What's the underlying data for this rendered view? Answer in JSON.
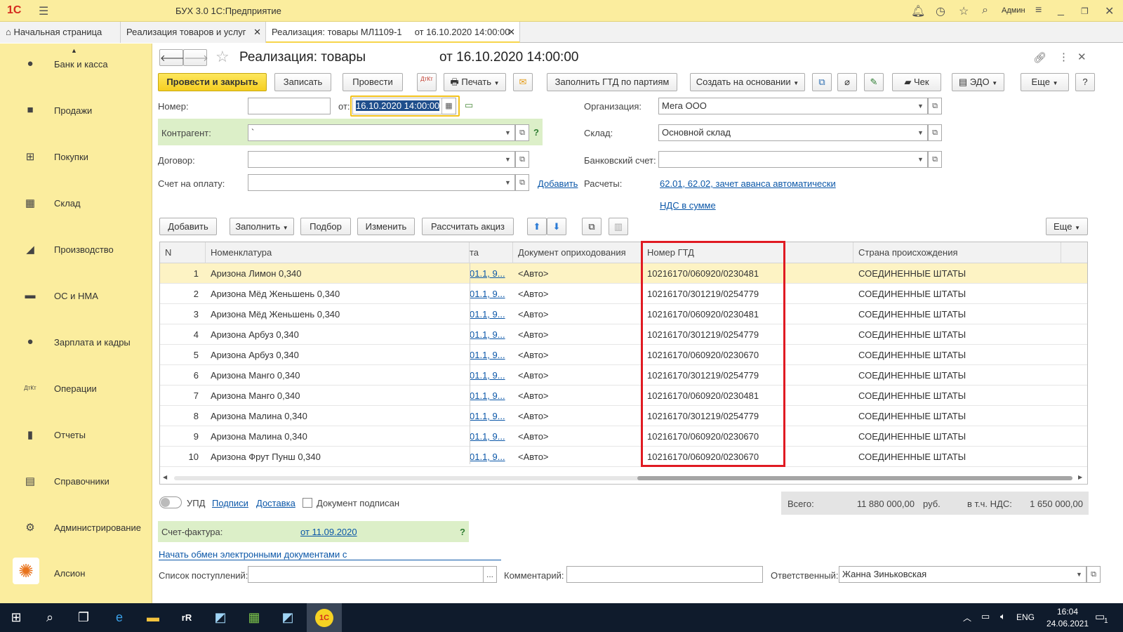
{
  "app": {
    "logo": "1С",
    "title": "БУХ 3.0 1С:Предприятие",
    "user": "Админ"
  },
  "tabs": [
    "Начальная страница",
    "Реализация товаров и услуг",
    "Реализация: товары МЛ1109-1     от 16.10.2020 14:00:00"
  ],
  "sidebar": [
    {
      "label": "Банк и касса",
      "icon": "bank-icon"
    },
    {
      "label": "Продажи",
      "icon": "bag-icon"
    },
    {
      "label": "Покупки",
      "icon": "cart-icon"
    },
    {
      "label": "Склад",
      "icon": "warehouse-icon"
    },
    {
      "label": "Производство",
      "icon": "factory-icon"
    },
    {
      "label": "ОС и НМА",
      "icon": "truck-icon"
    },
    {
      "label": "Зарплата и кадры",
      "icon": "person-icon"
    },
    {
      "label": "Операции",
      "icon": "dtkt-icon"
    },
    {
      "label": "Отчеты",
      "icon": "chart-icon"
    },
    {
      "label": "Справочники",
      "icon": "book-icon"
    },
    {
      "label": "Администрирование",
      "icon": "gear-icon"
    },
    {
      "label": "Алсион",
      "icon": "sun-logo-icon"
    }
  ],
  "doc": {
    "title": "Реализация: товары",
    "date_title": "от 16.10.2020 14:00:00"
  },
  "toolbar": {
    "post_close": "Провести и закрыть",
    "save": "Записать",
    "post": "Провести",
    "dtkt": "ДтКт",
    "print": "Печать",
    "fill_gtd": "Заполнить ГТД по партиям",
    "create_based": "Создать на основании",
    "check": "Чек",
    "edo": "ЭДО",
    "more": "Еще",
    "help": "?"
  },
  "form": {
    "number_label": "Номер:",
    "number_value": "",
    "from_label": "от:",
    "date_value": "16.10.2020 14:00:00",
    "org_label": "Организация:",
    "org_value": "Мега ООО",
    "counterparty_label": "Контрагент:",
    "counterparty_value": "`",
    "warehouse_label": "Склад:",
    "warehouse_value": "Основной склад",
    "contract_label": "Договор:",
    "contract_value": "",
    "bank_label": "Банковский счет:",
    "bank_value": "",
    "invoice_label": "Счет на оплату:",
    "invoice_value": "",
    "add_link": "Добавить",
    "calc_label": "Расчеты:",
    "calc_link": "62.01, 62.02, зачет аванса автоматически",
    "vat_link": "НДС в сумме"
  },
  "table_toolbar": {
    "add": "Добавить",
    "fill": "Заполнить",
    "select": "Подбор",
    "change": "Изменить",
    "excise": "Рассчитать акциз",
    "more": "Еще"
  },
  "table": {
    "headers": [
      "N",
      "Номенклатура",
      "та",
      "Документ оприходования",
      "Номер ГТД",
      "Страна происхождения"
    ],
    "rows": [
      {
        "n": "1",
        "item": "Аризона Лимон 0,340",
        "acc": "01.1, 9...",
        "doc": "<Авто>",
        "gtd": "10216170/060920/0230481",
        "country": "СОЕДИНЕННЫЕ ШТАТЫ"
      },
      {
        "n": "2",
        "item": "Аризона Мёд Женьшень 0,340",
        "acc": "01.1, 9...",
        "doc": "<Авто>",
        "gtd": "10216170/301219/0254779",
        "country": "СОЕДИНЕННЫЕ ШТАТЫ"
      },
      {
        "n": "3",
        "item": "Аризона Мёд Женьшень 0,340",
        "acc": "01.1, 9...",
        "doc": "<Авто>",
        "gtd": "10216170/060920/0230481",
        "country": "СОЕДИНЕННЫЕ ШТАТЫ"
      },
      {
        "n": "4",
        "item": "Аризона Арбуз 0,340",
        "acc": "01.1, 9...",
        "doc": "<Авто>",
        "gtd": "10216170/301219/0254779",
        "country": "СОЕДИНЕННЫЕ ШТАТЫ"
      },
      {
        "n": "5",
        "item": "Аризона Арбуз 0,340",
        "acc": "01.1, 9...",
        "doc": "<Авто>",
        "gtd": "10216170/060920/0230670",
        "country": "СОЕДИНЕННЫЕ ШТАТЫ"
      },
      {
        "n": "6",
        "item": "Аризона Манго 0,340",
        "acc": "01.1, 9...",
        "doc": "<Авто>",
        "gtd": "10216170/301219/0254779",
        "country": "СОЕДИНЕННЫЕ ШТАТЫ"
      },
      {
        "n": "7",
        "item": "Аризона Манго 0,340",
        "acc": "01.1, 9...",
        "doc": "<Авто>",
        "gtd": "10216170/060920/0230481",
        "country": "СОЕДИНЕННЫЕ ШТАТЫ"
      },
      {
        "n": "8",
        "item": "Аризона Малина 0,340",
        "acc": "01.1, 9...",
        "doc": "<Авто>",
        "gtd": "10216170/301219/0254779",
        "country": "СОЕДИНЕННЫЕ ШТАТЫ"
      },
      {
        "n": "9",
        "item": "Аризона Малина 0,340",
        "acc": "01.1, 9...",
        "doc": "<Авто>",
        "gtd": "10216170/060920/0230670",
        "country": "СОЕДИНЕННЫЕ ШТАТЫ"
      },
      {
        "n": "10",
        "item": "Аризона Фрут Пунш 0,340",
        "acc": "01.1, 9...",
        "doc": "<Авто>",
        "gtd": "10216170/060920/0230670",
        "country": "СОЕДИНЕННЫЕ ШТАТЫ"
      }
    ]
  },
  "footer": {
    "upd": "УПД",
    "signatures": "Подписи",
    "delivery": "Доставка",
    "signed": "Документ подписан",
    "total_label": "Всего:",
    "total_value": "11 880 000,00",
    "currency": "руб.",
    "vat_label": "в т.ч. НДС:",
    "vat_value": "1 650 000,00",
    "invoice_label": "Счет-фактура:",
    "invoice_link": " от 11.09.2020",
    "help": "?",
    "edo_link": "Начать обмен электронными документами с",
    "receipts_label": "Список поступлений:",
    "receipts_value": "",
    "ellipsis": "...",
    "comment_label": "Комментарий:",
    "comment_value": "",
    "responsible_label": "Ответственный:",
    "responsible_value": "Жанна Зиньковская"
  },
  "taskbar": {
    "lang": "ENG",
    "time": "16:04",
    "date": "24.06.2021",
    "notif": "1"
  },
  "colors": {
    "accent": "#fbed9e",
    "primary_button": "#f6cf21",
    "highlight_box": "#e01a22",
    "link": "#0b57a8"
  }
}
